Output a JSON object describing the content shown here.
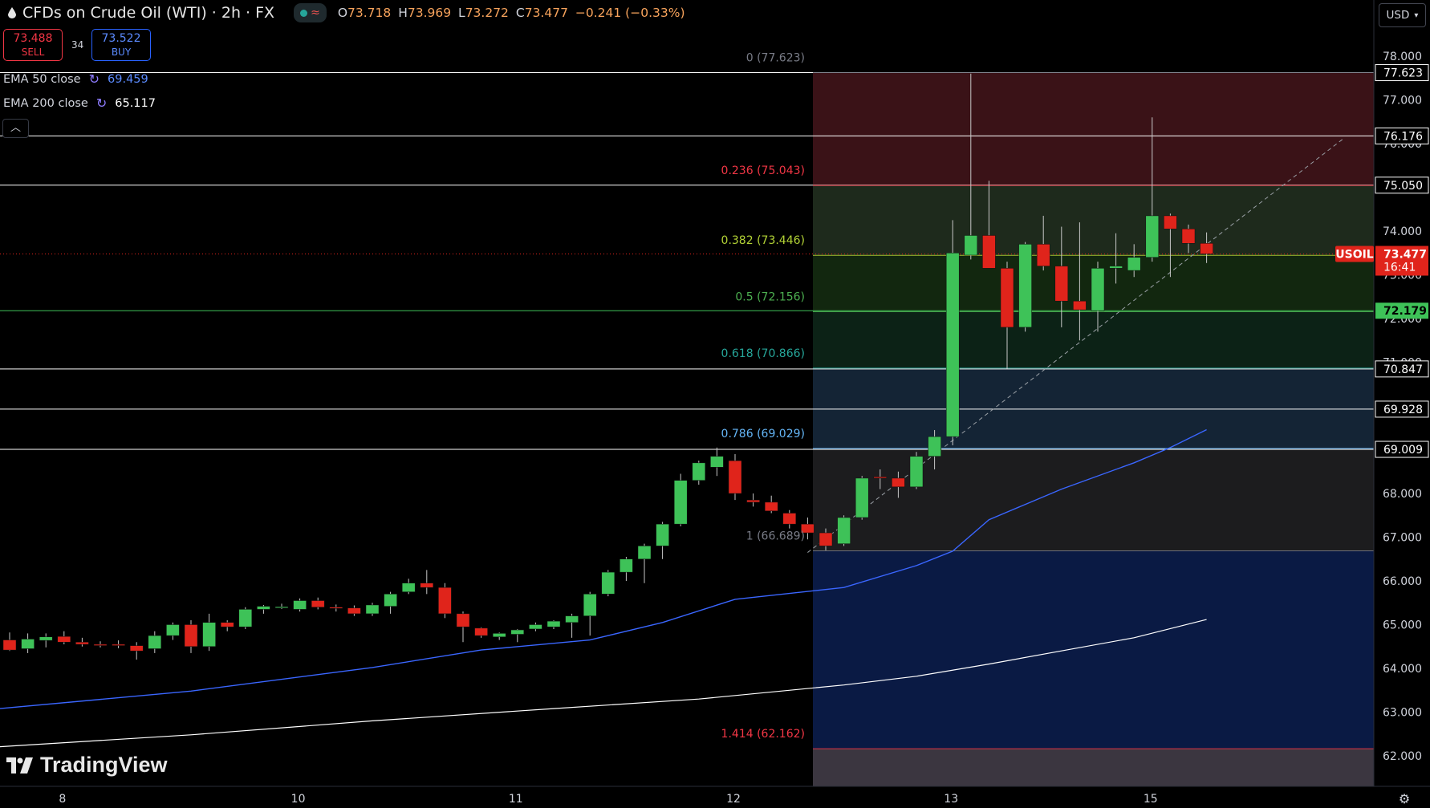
{
  "header": {
    "title": "CFDs on Crude Oil (WTI) · 2h · FX",
    "ohlc": [
      {
        "label": "O",
        "value": "73.718"
      },
      {
        "label": "H",
        "value": "73.969"
      },
      {
        "label": "L",
        "value": "73.272"
      },
      {
        "label": "C",
        "value": "73.477"
      },
      {
        "label": "",
        "value": "−0.241 (−0.33%)"
      }
    ]
  },
  "trade": {
    "sell_price": "73.488",
    "sell_label": "SELL",
    "spread": "34",
    "buy_price": "73.522",
    "buy_label": "BUY"
  },
  "indicators": [
    {
      "name": "EMA 50 close",
      "value": "69.459",
      "color": "#3a66ff"
    },
    {
      "name": "EMA 200 close",
      "value": "65.117",
      "color": "#ffffff"
    }
  ],
  "currency": "USD",
  "brand": "TradingView",
  "colors": {
    "up": "#3ec258",
    "down": "#e0241b",
    "ema50": "#3a66ff",
    "ema200": "#ffffff",
    "price_tag": "#e0241b",
    "green_tag": "#3ec258"
  },
  "chart_data": {
    "type": "candlestick",
    "symbol": "USOIL",
    "last_price": "73.477",
    "countdown": "16:41",
    "y_ticks": [
      "78.000",
      "77.000",
      "76.000",
      "75.000",
      "74.000",
      "73.000",
      "72.000",
      "71.000",
      "70.000",
      "69.000",
      "68.000",
      "67.000",
      "66.000",
      "65.000",
      "64.000",
      "63.000",
      "62.000"
    ],
    "x_labels": [
      {
        "label": "8",
        "bar": 3
      },
      {
        "label": "10",
        "bar": 16
      },
      {
        "label": "11",
        "bar": 28
      },
      {
        "label": "12",
        "bar": 40
      },
      {
        "label": "13",
        "bar": 52
      },
      {
        "label": "15",
        "bar": 63
      }
    ],
    "ylim": [
      61.2,
      79.0
    ],
    "fibonacci": [
      {
        "label": "0 (77.623)",
        "value": 77.623,
        "color": "#787b86"
      },
      {
        "label": "0.236 (75.043)",
        "value": 75.043,
        "color": "#f23645"
      },
      {
        "label": "0.382 (73.446)",
        "value": 73.446,
        "color": "#b2d235"
      },
      {
        "label": "0.5 (72.156)",
        "value": 72.156,
        "color": "#4caf50"
      },
      {
        "label": "0.618 (70.866)",
        "value": 70.866,
        "color": "#26a69a"
      },
      {
        "label": "0.786 (69.029)",
        "value": 69.029,
        "color": "#64b5f6"
      },
      {
        "label": "1 (66.689)",
        "value": 66.689,
        "color": "#787b86"
      },
      {
        "label": "1.414 (62.162)",
        "value": 62.162,
        "color": "#f23645"
      }
    ],
    "fib_zones": [
      {
        "from": 77.623,
        "to": 75.043,
        "color": "#3a1217"
      },
      {
        "from": 75.043,
        "to": 73.446,
        "color": "#1e2a1c"
      },
      {
        "from": 73.446,
        "to": 72.156,
        "color": "#12270f"
      },
      {
        "from": 72.156,
        "to": 70.866,
        "color": "#0c2216"
      },
      {
        "from": 70.866,
        "to": 69.029,
        "color": "#142435"
      },
      {
        "from": 69.029,
        "to": 66.689,
        "color": "#1c1c1e"
      },
      {
        "from": 66.689,
        "to": 62.162,
        "color": "#0a1a44"
      },
      {
        "from": 62.162,
        "to": 61.2,
        "color": "#3b3640"
      }
    ],
    "horizontal_lines": [
      {
        "value": 77.623,
        "label": "77.623"
      },
      {
        "value": 76.176,
        "label": "76.176"
      },
      {
        "value": 75.05,
        "label": "75.050"
      },
      {
        "value": 72.179,
        "label": "72.179",
        "tag": "green"
      },
      {
        "value": 70.847,
        "label": "70.847"
      },
      {
        "value": 69.928,
        "label": "69.928"
      },
      {
        "value": 69.009,
        "label": "69.009"
      }
    ],
    "candles": [
      {
        "o": 64.65,
        "h": 64.82,
        "l": 64.4,
        "c": 64.42
      },
      {
        "o": 64.45,
        "h": 64.8,
        "l": 64.35,
        "c": 64.67
      },
      {
        "o": 64.64,
        "h": 64.8,
        "l": 64.48,
        "c": 64.72
      },
      {
        "o": 64.73,
        "h": 64.85,
        "l": 64.55,
        "c": 64.6
      },
      {
        "o": 64.6,
        "h": 64.7,
        "l": 64.5,
        "c": 64.55
      },
      {
        "o": 64.55,
        "h": 64.62,
        "l": 64.48,
        "c": 64.54
      },
      {
        "o": 64.55,
        "h": 64.64,
        "l": 64.46,
        "c": 64.54
      },
      {
        "o": 64.52,
        "h": 64.6,
        "l": 64.2,
        "c": 64.4
      },
      {
        "o": 64.45,
        "h": 64.85,
        "l": 64.35,
        "c": 64.75
      },
      {
        "o": 64.75,
        "h": 65.05,
        "l": 64.65,
        "c": 65.0
      },
      {
        "o": 65.0,
        "h": 65.1,
        "l": 64.35,
        "c": 64.5
      },
      {
        "o": 64.5,
        "h": 65.25,
        "l": 64.4,
        "c": 65.05
      },
      {
        "o": 65.05,
        "h": 65.1,
        "l": 64.85,
        "c": 64.95
      },
      {
        "o": 64.95,
        "h": 65.4,
        "l": 64.9,
        "c": 65.35
      },
      {
        "o": 65.35,
        "h": 65.45,
        "l": 65.25,
        "c": 65.42
      },
      {
        "o": 65.4,
        "h": 65.48,
        "l": 65.36,
        "c": 65.41
      },
      {
        "o": 65.35,
        "h": 65.6,
        "l": 65.3,
        "c": 65.55
      },
      {
        "o": 65.55,
        "h": 65.62,
        "l": 65.35,
        "c": 65.4
      },
      {
        "o": 65.4,
        "h": 65.46,
        "l": 65.3,
        "c": 65.38
      },
      {
        "o": 65.38,
        "h": 65.44,
        "l": 65.2,
        "c": 65.25
      },
      {
        "o": 65.25,
        "h": 65.5,
        "l": 65.2,
        "c": 65.45
      },
      {
        "o": 65.42,
        "h": 65.75,
        "l": 65.25,
        "c": 65.7
      },
      {
        "o": 65.75,
        "h": 66.05,
        "l": 65.7,
        "c": 65.95
      },
      {
        "o": 65.95,
        "h": 66.25,
        "l": 65.7,
        "c": 65.85
      },
      {
        "o": 65.85,
        "h": 65.95,
        "l": 65.15,
        "c": 65.25
      },
      {
        "o": 65.25,
        "h": 65.3,
        "l": 64.6,
        "c": 64.95
      },
      {
        "o": 64.92,
        "h": 64.94,
        "l": 64.7,
        "c": 64.75
      },
      {
        "o": 64.72,
        "h": 64.82,
        "l": 64.65,
        "c": 64.8
      },
      {
        "o": 64.78,
        "h": 64.9,
        "l": 64.6,
        "c": 64.88
      },
      {
        "o": 64.9,
        "h": 65.05,
        "l": 64.85,
        "c": 65.0
      },
      {
        "o": 64.95,
        "h": 65.1,
        "l": 64.9,
        "c": 65.08
      },
      {
        "o": 65.05,
        "h": 65.25,
        "l": 64.7,
        "c": 65.2
      },
      {
        "o": 65.2,
        "h": 65.75,
        "l": 64.75,
        "c": 65.7
      },
      {
        "o": 65.7,
        "h": 66.25,
        "l": 65.65,
        "c": 66.2
      },
      {
        "o": 66.2,
        "h": 66.55,
        "l": 66.0,
        "c": 66.5
      },
      {
        "o": 66.5,
        "h": 66.85,
        "l": 65.95,
        "c": 66.8
      },
      {
        "o": 66.8,
        "h": 67.35,
        "l": 66.5,
        "c": 67.3
      },
      {
        "o": 67.3,
        "h": 68.45,
        "l": 67.25,
        "c": 68.3
      },
      {
        "o": 68.3,
        "h": 68.75,
        "l": 68.2,
        "c": 68.7
      },
      {
        "o": 68.6,
        "h": 69.05,
        "l": 68.4,
        "c": 68.85
      },
      {
        "o": 68.75,
        "h": 68.9,
        "l": 67.85,
        "c": 68.0
      },
      {
        "o": 67.85,
        "h": 68.0,
        "l": 67.7,
        "c": 67.8
      },
      {
        "o": 67.8,
        "h": 67.95,
        "l": 67.55,
        "c": 67.6
      },
      {
        "o": 67.55,
        "h": 67.62,
        "l": 67.2,
        "c": 67.3
      },
      {
        "o": 67.3,
        "h": 67.45,
        "l": 66.95,
        "c": 67.1
      },
      {
        "o": 67.1,
        "h": 67.2,
        "l": 66.7,
        "c": 66.8
      },
      {
        "o": 66.85,
        "h": 67.5,
        "l": 66.8,
        "c": 67.45
      },
      {
        "o": 67.45,
        "h": 68.4,
        "l": 67.4,
        "c": 68.35
      },
      {
        "o": 68.38,
        "h": 68.55,
        "l": 68.1,
        "c": 68.35
      },
      {
        "o": 68.35,
        "h": 68.5,
        "l": 67.9,
        "c": 68.15
      },
      {
        "o": 68.15,
        "h": 68.95,
        "l": 68.1,
        "c": 68.85
      },
      {
        "o": 68.85,
        "h": 69.45,
        "l": 68.55,
        "c": 69.3
      },
      {
        "o": 69.3,
        "h": 74.25,
        "l": 69.1,
        "c": 73.5
      },
      {
        "o": 73.45,
        "h": 77.6,
        "l": 73.35,
        "c": 73.9
      },
      {
        "o": 73.9,
        "h": 75.15,
        "l": 73.2,
        "c": 73.15
      },
      {
        "o": 73.15,
        "h": 73.3,
        "l": 70.85,
        "c": 71.8
      },
      {
        "o": 71.8,
        "h": 73.75,
        "l": 71.7,
        "c": 73.7
      },
      {
        "o": 73.7,
        "h": 74.35,
        "l": 73.1,
        "c": 73.2
      },
      {
        "o": 73.2,
        "h": 74.1,
        "l": 71.8,
        "c": 72.4
      },
      {
        "o": 72.4,
        "h": 74.2,
        "l": 71.5,
        "c": 72.2
      },
      {
        "o": 72.18,
        "h": 73.3,
        "l": 71.7,
        "c": 73.15
      },
      {
        "o": 73.15,
        "h": 73.95,
        "l": 72.8,
        "c": 73.2
      },
      {
        "o": 73.1,
        "h": 73.7,
        "l": 72.95,
        "c": 73.4
      },
      {
        "o": 73.4,
        "h": 76.6,
        "l": 73.3,
        "c": 74.35
      },
      {
        "o": 74.35,
        "h": 74.4,
        "l": 72.95,
        "c": 74.05
      },
      {
        "o": 74.05,
        "h": 74.15,
        "l": 73.5,
        "c": 73.72
      },
      {
        "o": 73.72,
        "h": 73.97,
        "l": 73.27,
        "c": 73.48
      }
    ],
    "ema50": [
      [
        0,
        63.08
      ],
      [
        10,
        63.48
      ],
      [
        20,
        64.02
      ],
      [
        26,
        64.42
      ],
      [
        32,
        64.65
      ],
      [
        36,
        65.05
      ],
      [
        40,
        65.58
      ],
      [
        46,
        65.85
      ],
      [
        50,
        66.35
      ],
      [
        52,
        66.68
      ],
      [
        54,
        67.4
      ],
      [
        58,
        68.1
      ],
      [
        62,
        68.7
      ],
      [
        64,
        69.05
      ],
      [
        66,
        69.459
      ]
    ],
    "ema200": [
      [
        0,
        62.21
      ],
      [
        10,
        62.48
      ],
      [
        20,
        62.8
      ],
      [
        30,
        63.08
      ],
      [
        38,
        63.3
      ],
      [
        46,
        63.62
      ],
      [
        50,
        63.82
      ],
      [
        54,
        64.1
      ],
      [
        58,
        64.4
      ],
      [
        62,
        64.7
      ],
      [
        66,
        65.117
      ]
    ],
    "trendline": [
      [
        44,
        66.65
      ],
      [
        73.5,
        76.1
      ]
    ]
  }
}
